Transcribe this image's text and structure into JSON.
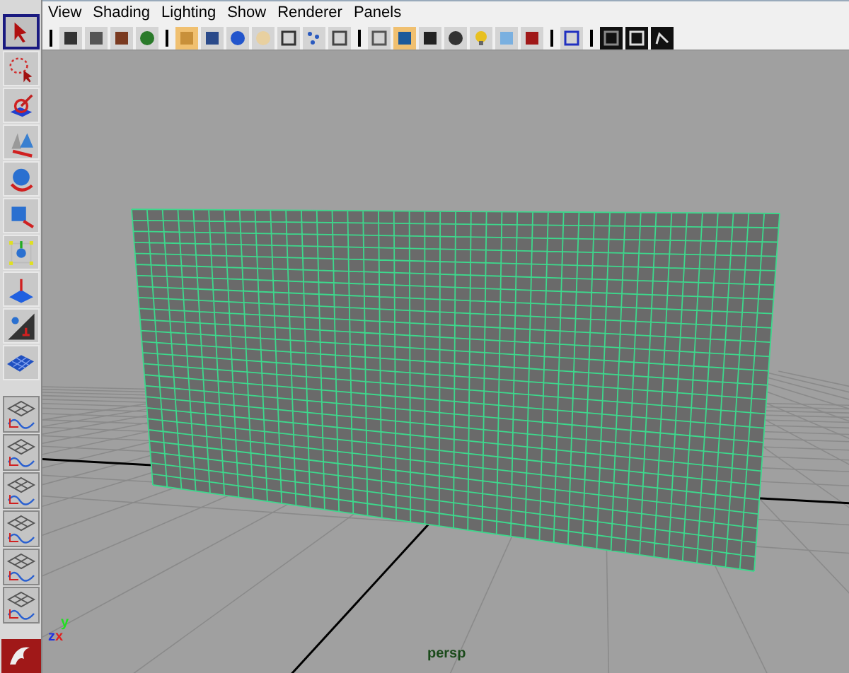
{
  "menu_bar": {
    "items": [
      "View",
      "Shading",
      "Lighting",
      "Show",
      "Renderer",
      "Panels"
    ]
  },
  "panel_toolbar": {
    "groups": [
      [
        {
          "selected": false
        },
        {
          "selected": false
        },
        {
          "selected": false
        },
        {
          "selected": false
        }
      ],
      [
        {
          "selected": true
        },
        {
          "selected": false
        },
        {
          "selected": false
        },
        {
          "selected": false
        },
        {
          "selected": false
        },
        {
          "selected": false
        },
        {
          "selected": false
        }
      ],
      [
        {
          "selected": false
        },
        {
          "selected": true
        },
        {
          "selected": false
        },
        {
          "selected": false
        },
        {
          "selected": false
        },
        {
          "selected": false
        },
        {
          "selected": false
        }
      ],
      [
        {
          "selected": false
        }
      ],
      [
        {
          "selected": false
        },
        {
          "selected": false
        },
        {
          "selected": false
        }
      ]
    ]
  },
  "tool_box": {
    "tools": [
      {
        "selected": true
      },
      {
        "selected": false
      },
      {
        "selected": false
      },
      {
        "selected": false
      },
      {
        "selected": false
      },
      {
        "selected": false
      },
      {
        "selected": false
      },
      {
        "selected": false
      },
      {
        "selected": false
      },
      {
        "selected": false
      }
    ]
  },
  "viewport": {
    "axis_labels": {
      "y": "y",
      "z": "z",
      "x": "x"
    },
    "camera": "persp"
  }
}
